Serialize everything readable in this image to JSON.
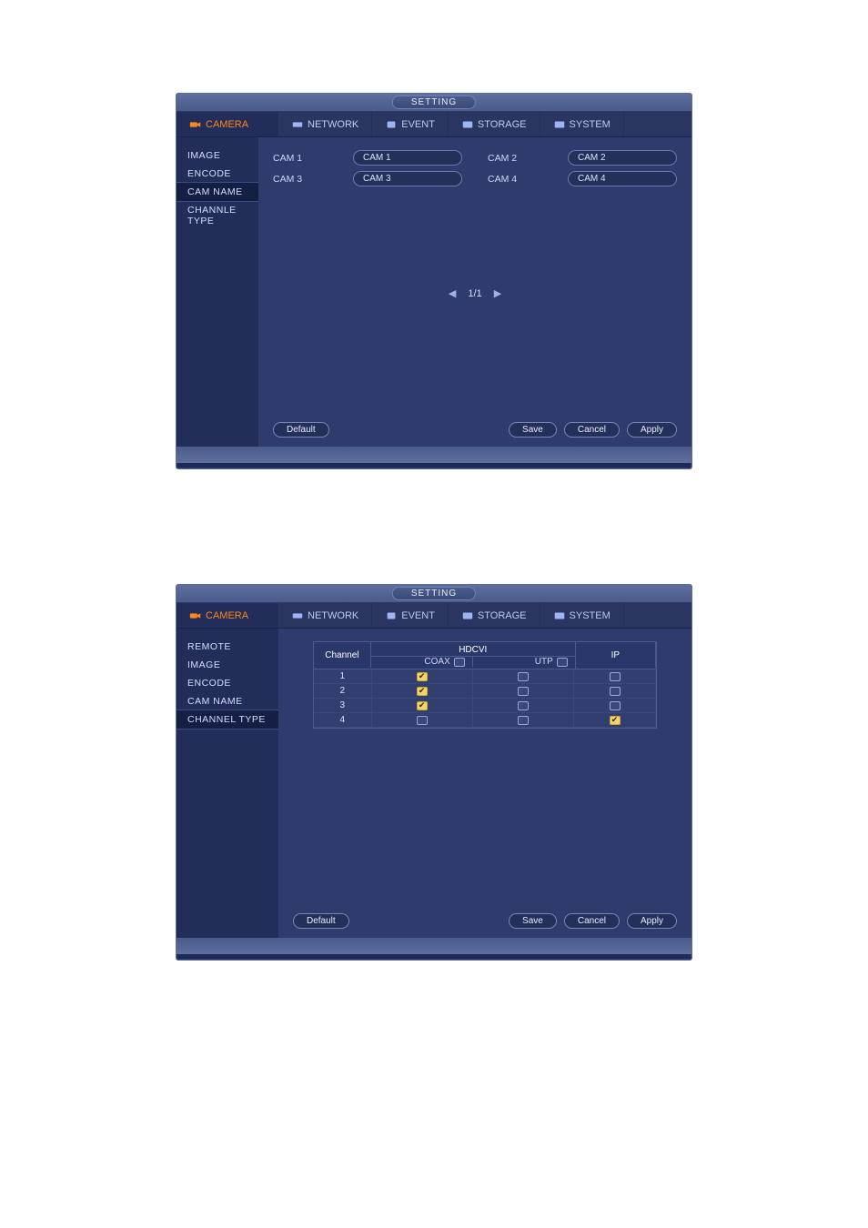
{
  "window_title": "SETTING",
  "tabs": {
    "camera": "CAMERA",
    "network": "NETWORK",
    "event": "EVENT",
    "storage": "STORAGE",
    "system": "SYSTEM"
  },
  "panel1": {
    "sidebar": [
      "IMAGE",
      "ENCODE",
      "CAM NAME",
      "CHANNLE TYPE"
    ],
    "selected_index": 2,
    "cams": [
      {
        "label": "CAM 1",
        "value": "CAM 1"
      },
      {
        "label": "CAM 2",
        "value": "CAM 2"
      },
      {
        "label": "CAM 3",
        "value": "CAM 3"
      },
      {
        "label": "CAM 4",
        "value": "CAM 4"
      }
    ],
    "pager": "1/1"
  },
  "panel2": {
    "sidebar": [
      "REMOTE",
      "IMAGE",
      "ENCODE",
      "CAM NAME",
      "CHANNEL TYPE"
    ],
    "selected_index": 4,
    "table": {
      "head_channel": "Channel",
      "head_group": "HDCVI",
      "head_coax": "COAX",
      "head_utp": "UTP",
      "head_ip": "IP",
      "rows": [
        {
          "ch": "1",
          "coax": true,
          "utp": false,
          "ip": false
        },
        {
          "ch": "2",
          "coax": true,
          "utp": false,
          "ip": false
        },
        {
          "ch": "3",
          "coax": true,
          "utp": false,
          "ip": false
        },
        {
          "ch": "4",
          "coax": false,
          "utp": false,
          "ip": true
        }
      ]
    }
  },
  "buttons": {
    "default": "Default",
    "save": "Save",
    "cancel": "Cancel",
    "apply": "Apply"
  }
}
